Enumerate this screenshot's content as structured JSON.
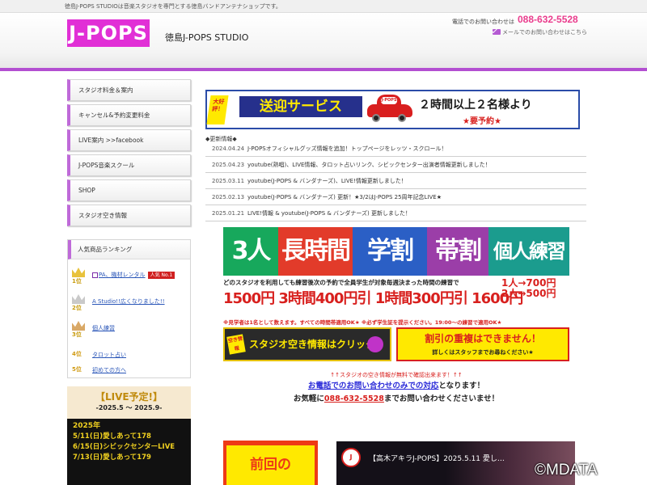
{
  "topbar": {
    "text": "徳島J-POPS STUDIOは音楽スタジオを専門とする徳島バンドアンテナショップです。"
  },
  "header": {
    "logo_text": "J-POPS",
    "site_title": "徳島J-POPS STUDIO",
    "tel_label": "電話でのお問い合わせは",
    "tel_number": "088-632-5528",
    "mail_label": "メールでのお問い合わせはこちら",
    "accent_color": "#b34fd1"
  },
  "sidebar": {
    "items": [
      {
        "label": "スタジオ料金＆案内"
      },
      {
        "label": "キャンセル&予約変更料金"
      },
      {
        "label": "LIVE案内 >>facebook"
      },
      {
        "label": "J-POPS音楽スクール"
      },
      {
        "label": "SHOP"
      },
      {
        "label": "スタジオ空き情報"
      }
    ]
  },
  "ranking": {
    "title": "人気商品ランキング",
    "items": [
      {
        "pos": "1位",
        "label": "PA、機材レンタル",
        "badge": "人気 No.1"
      },
      {
        "pos": "2位",
        "label": "A Studio!!広くなりました!!"
      },
      {
        "pos": "3位",
        "label": "個人練習"
      },
      {
        "pos": "4位",
        "label": "タロット占い"
      },
      {
        "pos": "5位",
        "label": "初めての方へ"
      }
    ]
  },
  "live_schedule": {
    "title": "【LIVE予定!】",
    "range": "-2025.5 ～ 2025.9-",
    "year": "2025年",
    "lines": [
      "5/11(日)愛しあって178",
      "6/15(日)シビックセンターLIVE",
      "7/13(日)愛しあって179"
    ]
  },
  "pickup_banner": {
    "tag": "大好評！",
    "title": "送迎サービス",
    "car_label": "J-POPS",
    "text": "２時間以上２名様より",
    "sub": "★要予約★"
  },
  "news": {
    "heading": "◆更新情報◆",
    "items": [
      {
        "date": "2024.04.24",
        "text": "J-POPSオフィシャルグッズ情報を追加！トップページをレッツ・スクロール！"
      },
      {
        "date": "2025.04.23",
        "text": "youtube(熟唱)、LIVE情報、タロット占いリンク、シビックセンター出演者情報更新しました！"
      },
      {
        "date": "2025.03.11",
        "text": "youtube(J-POPS & バンダナーズ)、LIVE!情報更新しました！"
      },
      {
        "date": "2025.02.13",
        "text": "youtube(J-POPS & バンダナーズ) 更新！★3/2はJ-POPS 25周年記念LIVE★"
      },
      {
        "date": "2025.01.21",
        "text": "LIVE!情報 & youtube(J-POPS & バンダナーズ) 更新しました！"
      }
    ]
  },
  "discount": {
    "words": [
      "3人割",
      "長時間割",
      "学割",
      "帯割",
      "個人練習"
    ],
    "note": "どのスタジオを利用しても練習後次の予約で全員学生が対象毎週決まった時間の練習で",
    "prices": "1500円 3時間400円引 1時間300円引 1600円",
    "right": [
      "1人→700円",
      "2人→500円"
    ],
    "small": "※見学者は1名として数えます。すべての時間帯適用OK★ ※必ず学生証を提示ください。19:00～の練習で適用OK★",
    "button_left": "スタジオ空き情報はクリック",
    "button_left_tag": "空き情報",
    "button_right": "割引の重複はできません！",
    "button_right_sub": "詳しくはスタッフまでお尋ねください★"
  },
  "contact": {
    "line1": "↑↑スタジオの空き情報が無料で確認出来ます！↑↑",
    "line2_link": "お電話でのお問い合わせのみでの対応",
    "line2_rest": "となります！",
    "line3_pre": "お気軽に",
    "line3_tel": "088-632-5528",
    "line3_post": "までお問い合わせくださいませ！"
  },
  "prev_banner": {
    "text": "前回の"
  },
  "video": {
    "avatar": "J",
    "title": "【高木アキラJ-POPS】2025.5.11 愛し…"
  },
  "watermark": "©MDATA"
}
